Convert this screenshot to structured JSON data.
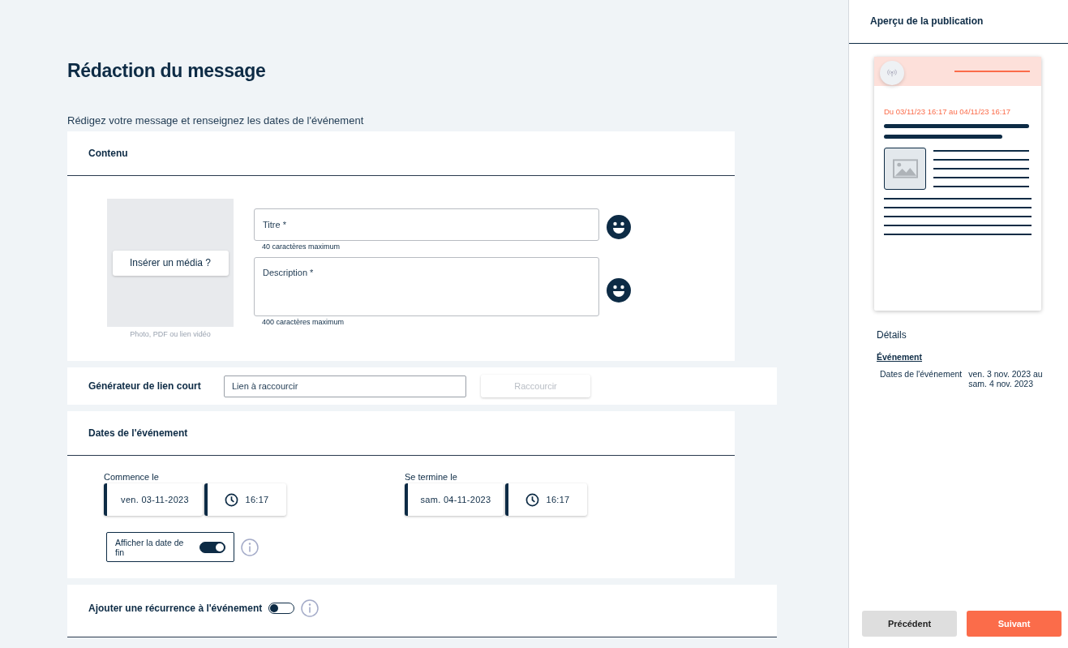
{
  "page": {
    "title": "Rédaction du message",
    "subtitle": "Rédigez votre message et renseignez les dates de l'événement"
  },
  "content_section": {
    "title": "Contenu",
    "media_button": "Insérer un média ?",
    "media_hint": "Photo, PDF ou lien vidéo",
    "fields": [
      {
        "kind": "line",
        "placeholder": "Titre *",
        "hint": "40 caractères maximum"
      },
      {
        "kind": "area",
        "placeholder": "Description *",
        "hint": "400 caractères maximum"
      }
    ]
  },
  "link_generator": {
    "title": "Générateur de lien court",
    "placeholder": "Lien à raccourcir",
    "button": "Raccourcir",
    "button_disabled": true
  },
  "dates_section": {
    "title": "Dates de l'événement",
    "ranges": [
      {
        "label": "Commence le",
        "date": "ven. 03-11-2023",
        "time": "16:17"
      },
      {
        "label": "Se termine le",
        "date": "sam. 04-11-2023",
        "time": "16:17"
      }
    ],
    "show_end_toggle": {
      "label": "Afficher la date de fin",
      "on": true
    }
  },
  "recurrence": {
    "label": "Ajouter une récurrence à l'événement",
    "on": false
  },
  "preview": {
    "title": "Aperçu de la publication",
    "card_dates": "Du 03/11/23 16:17 au 04/11/23 16:17",
    "details_title": "Détails",
    "details_subtitle": "Événement",
    "details": [
      {
        "label": "Dates de l'événement",
        "value": "ven. 3 nov. 2023 au sam. 4 nov. 2023"
      }
    ]
  },
  "buttons": [
    {
      "kind": "secondary",
      "label": "Précédent"
    },
    {
      "kind": "primary",
      "label": "Suivant"
    }
  ]
}
